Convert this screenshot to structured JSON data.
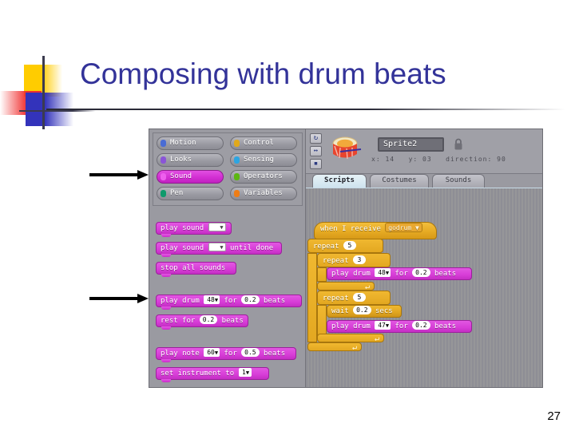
{
  "slide": {
    "title": "Composing with drum beats",
    "page_number": "27",
    "annotations": [
      {
        "name": "arrow-to-palette-top"
      },
      {
        "name": "arrow-to-palette-bottom"
      }
    ]
  },
  "scratch": {
    "categories": [
      {
        "label": "Motion",
        "color": "#4a6cd4",
        "selected": false
      },
      {
        "label": "Looks",
        "color": "#8a55d7",
        "selected": false
      },
      {
        "label": "Sound",
        "color": "#bb42c3",
        "selected": true
      },
      {
        "label": "Pen",
        "color": "#0e9a6c",
        "selected": false
      },
      {
        "label": "Control",
        "color": "#e1a91a",
        "selected": false
      },
      {
        "label": "Sensing",
        "color": "#2ca5e2",
        "selected": false
      },
      {
        "label": "Operators",
        "color": "#5cb712",
        "selected": false
      },
      {
        "label": "Variables",
        "color": "#ee7d16",
        "selected": false
      }
    ],
    "palette_blocks": [
      {
        "name": "play-sound-block",
        "text_before": "play sound",
        "field": "",
        "field_type": "dropdown-empty",
        "text_after": ""
      },
      {
        "name": "play-sound-until-done-block",
        "text_before": "play sound",
        "field": "",
        "field_type": "dropdown-empty",
        "text_after": "until done"
      },
      {
        "name": "stop-all-sounds-block",
        "text_before": "stop all sounds",
        "field": "",
        "field_type": "none",
        "text_after": ""
      },
      {
        "name": "play-drum-block",
        "text_before": "play drum",
        "field": "48",
        "field_type": "dropdown",
        "mid": "for",
        "field2": "0.2",
        "text_after": "beats"
      },
      {
        "name": "rest-for-block",
        "text_before": "rest for",
        "field": "0.2",
        "field_type": "number",
        "text_after": "beats"
      },
      {
        "name": "play-note-block",
        "text_before": "play note",
        "field": "60",
        "field_type": "dropdown",
        "mid": "for",
        "field2": "0.5",
        "text_after": "beats"
      },
      {
        "name": "set-instrument-block",
        "text_before": "set instrument to",
        "field": "1",
        "field_type": "dropdown",
        "text_after": ""
      }
    ],
    "sprite": {
      "name": "Sprite2",
      "x_label": "x:",
      "x_value": "14",
      "y_label": "y:",
      "y_value": "03",
      "direction_label": "direction:",
      "direction_value": "90",
      "rotation_buttons": [
        "rotate-icon",
        "flip-icon",
        "no-rotate-icon"
      ],
      "lock_icon": "lock-icon",
      "thumbnail": "drum-sprite-icon"
    },
    "tabs": [
      {
        "label": "Scripts",
        "active": true
      },
      {
        "label": "Costumes",
        "active": false
      },
      {
        "label": "Sounds",
        "active": false
      }
    ],
    "script": {
      "hat": {
        "text": "when I receive",
        "message": "godrum"
      },
      "outer_repeat": {
        "label": "repeat",
        "count": "5"
      },
      "inner_repeat_1": {
        "label": "repeat",
        "count": "3"
      },
      "drum_1": {
        "text_before": "play drum",
        "drum": "48",
        "mid": "for",
        "beats": "0.2",
        "text_after": "beats"
      },
      "inner_repeat_2": {
        "label": "repeat",
        "count": "5"
      },
      "wait": {
        "text_before": "wait",
        "secs": "0.2",
        "text_after": "secs"
      },
      "drum_2": {
        "text_before": "play drum",
        "drum": "47",
        "mid": "for",
        "beats": "0.2",
        "text_after": "beats"
      }
    }
  }
}
